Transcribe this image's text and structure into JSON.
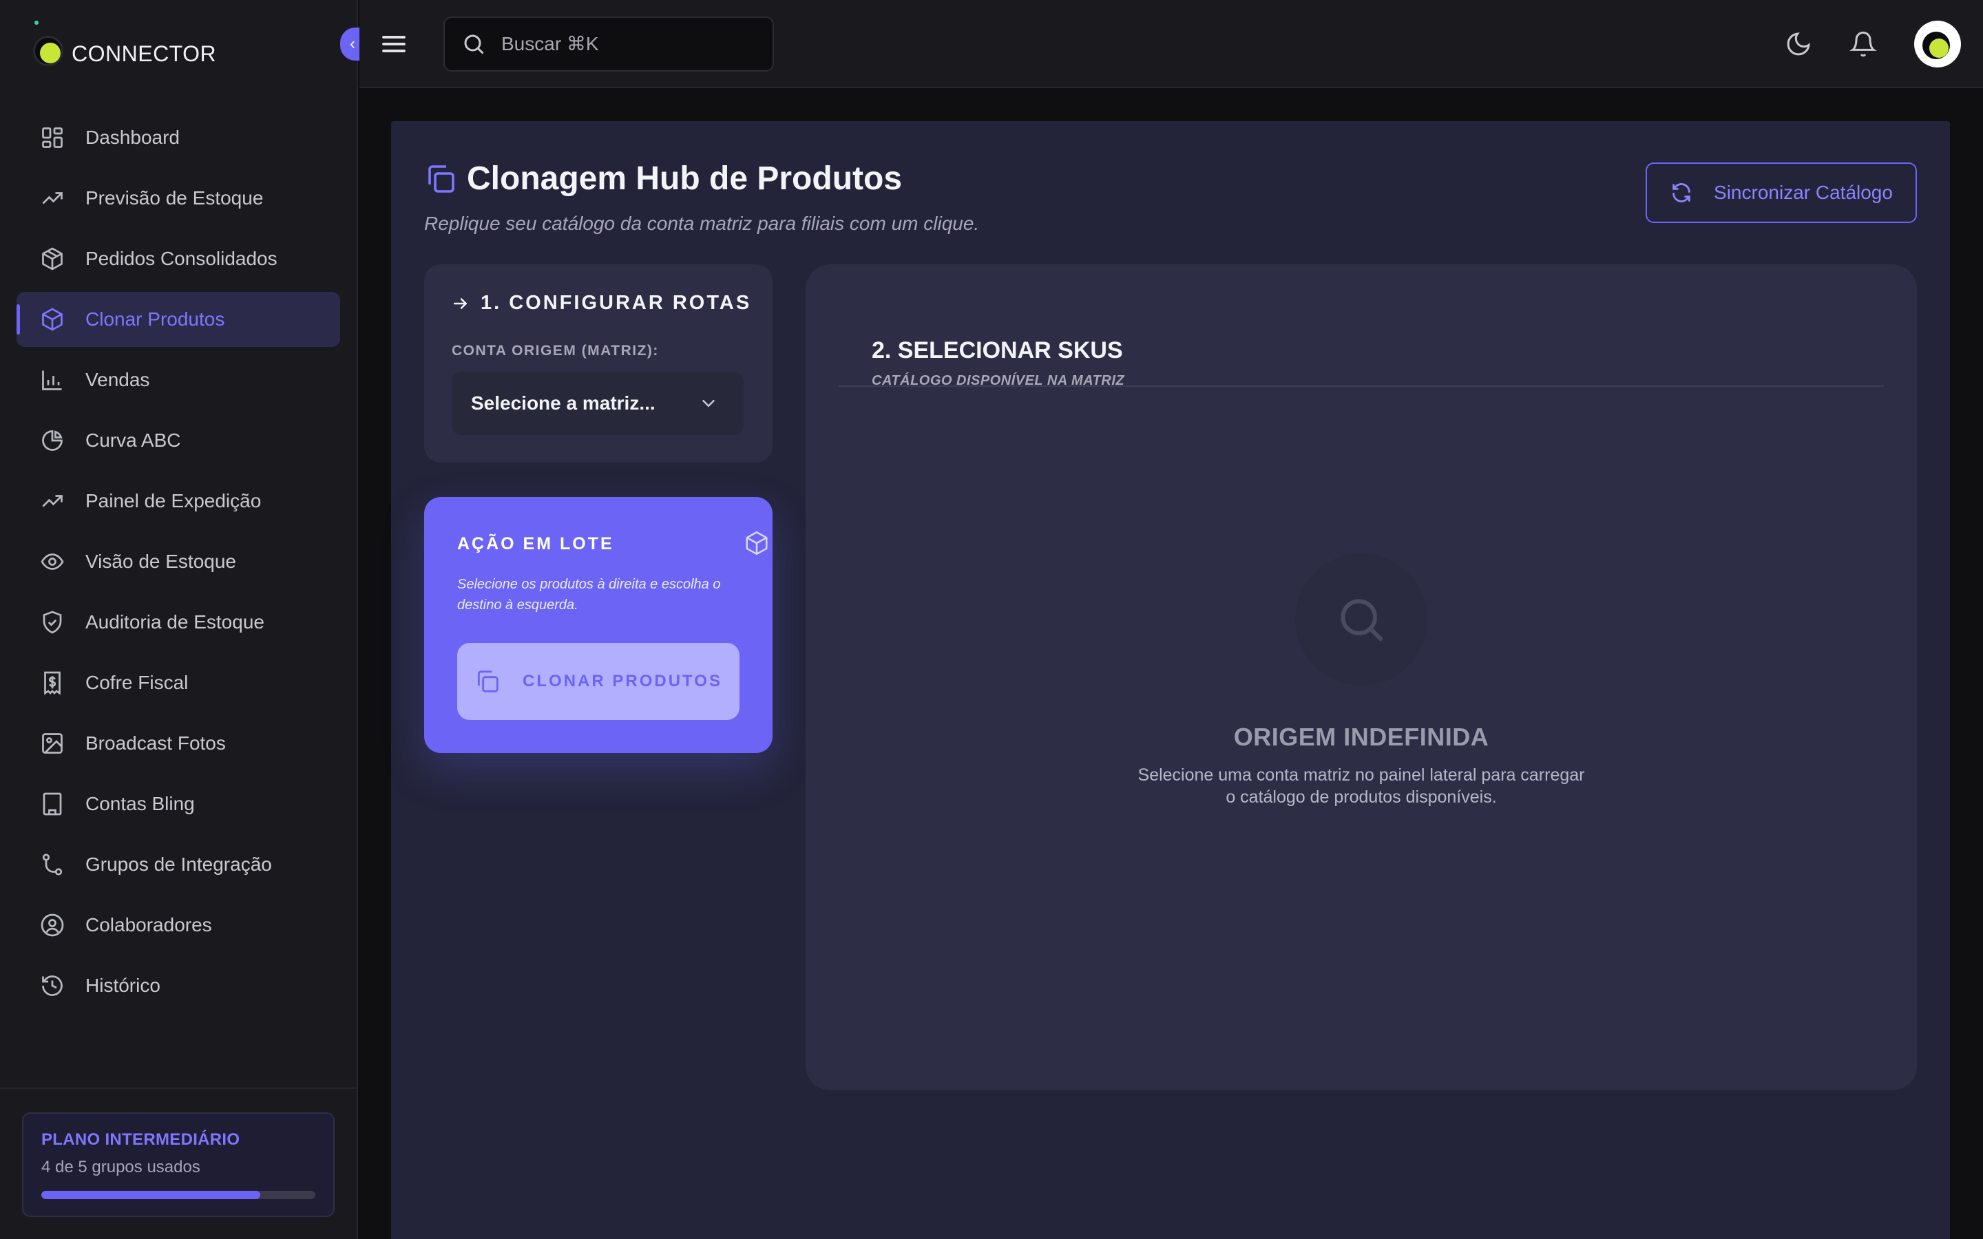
{
  "app": {
    "logo_text": "CONNECTOR"
  },
  "sidebar": {
    "items": [
      {
        "label": "Dashboard",
        "icon": "grid-icon"
      },
      {
        "label": "Previsão de Estoque",
        "icon": "trending-up-icon"
      },
      {
        "label": "Pedidos Consolidados",
        "icon": "package-icon"
      },
      {
        "label": "Clonar Produtos",
        "icon": "box-icon",
        "active": true
      },
      {
        "label": "Vendas",
        "icon": "bar-chart-icon"
      },
      {
        "label": "Curva ABC",
        "icon": "pie-chart-icon"
      },
      {
        "label": "Painel de Expedição",
        "icon": "trending-up-icon"
      },
      {
        "label": "Visão de Estoque",
        "icon": "eye-icon"
      },
      {
        "label": "Auditoria de Estoque",
        "icon": "shield-check-icon"
      },
      {
        "label": "Cofre Fiscal",
        "icon": "receipt-icon"
      },
      {
        "label": "Broadcast Fotos",
        "icon": "image-icon"
      },
      {
        "label": "Contas Bling",
        "icon": "building-icon"
      },
      {
        "label": "Grupos de Integração",
        "icon": "git-branch-icon"
      },
      {
        "label": "Colaboradores",
        "icon": "user-circle-icon"
      },
      {
        "label": "Histórico",
        "icon": "history-icon"
      }
    ],
    "plan": {
      "title": "PLANO INTERMEDIÁRIO",
      "usage": "4 de 5 grupos usados",
      "used": 4,
      "total": 5
    }
  },
  "topbar": {
    "search_placeholder": "Buscar ⌘K"
  },
  "page": {
    "title": "Clonagem Hub de Produtos",
    "subtitle": "Replique seu catálogo da conta matriz para filiais com um clique.",
    "sync_button": "Sincronizar Catálogo"
  },
  "routes": {
    "title": "1. CONFIGURAR ROTAS",
    "source_label": "CONTA ORIGEM (MATRIZ):",
    "source_placeholder": "Selecione a matriz..."
  },
  "batch": {
    "title": "AÇÃO EM LOTE",
    "description": "Selecione os produtos à direita e escolha o destino à esquerda.",
    "clone_button": "CLONAR PRODUTOS"
  },
  "skus": {
    "title": "2. SELECIONAR SKUS",
    "subtitle": "CATÁLOGO DISPONÍVEL NA MATRIZ",
    "empty_title": "ORIGEM INDEFINIDA",
    "empty_description": "Selecione uma conta matriz no painel lateral para carregar o catálogo de produtos disponíveis."
  },
  "colors": {
    "accent": "#6b64f5",
    "accent_text": "#7d77ff",
    "sidebar_bg": "#1a1a1e",
    "main_bg": "#23243a",
    "card_bg": "#2d2e46"
  }
}
